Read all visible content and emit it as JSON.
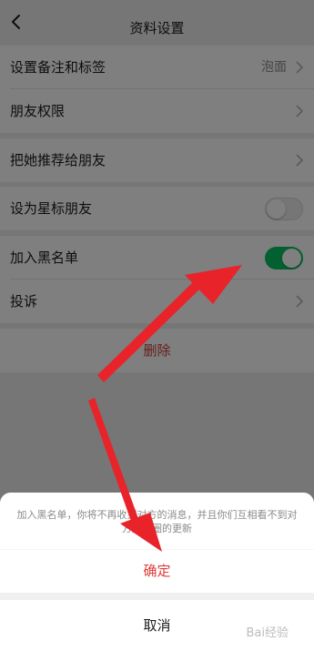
{
  "header": {
    "title": "资料设置"
  },
  "rows": [
    {
      "label": "设置备注和标签",
      "value": "泡面"
    },
    {
      "label": "朋友权限"
    },
    {
      "label": "把她推荐给朋友"
    },
    {
      "label": "设为星标朋友",
      "toggle": "off"
    },
    {
      "label": "加入黑名单",
      "toggle": "on"
    },
    {
      "label": "投诉"
    }
  ],
  "delete_label": "删除",
  "dialog": {
    "message": "加入黑名单，你将不再收到对方的消息，并且你们互相看不到对方朋友圈的更新",
    "confirm_label": "确定",
    "cancel_label": "取消"
  },
  "watermark": "Bai经验",
  "colors": {
    "toggle_on": "#07c160",
    "danger": "#e03a3a",
    "arrow": "#e8232a"
  },
  "icons": [
    "back-arrow-icon",
    "chevron-right-icon",
    "annotation-arrow"
  ]
}
